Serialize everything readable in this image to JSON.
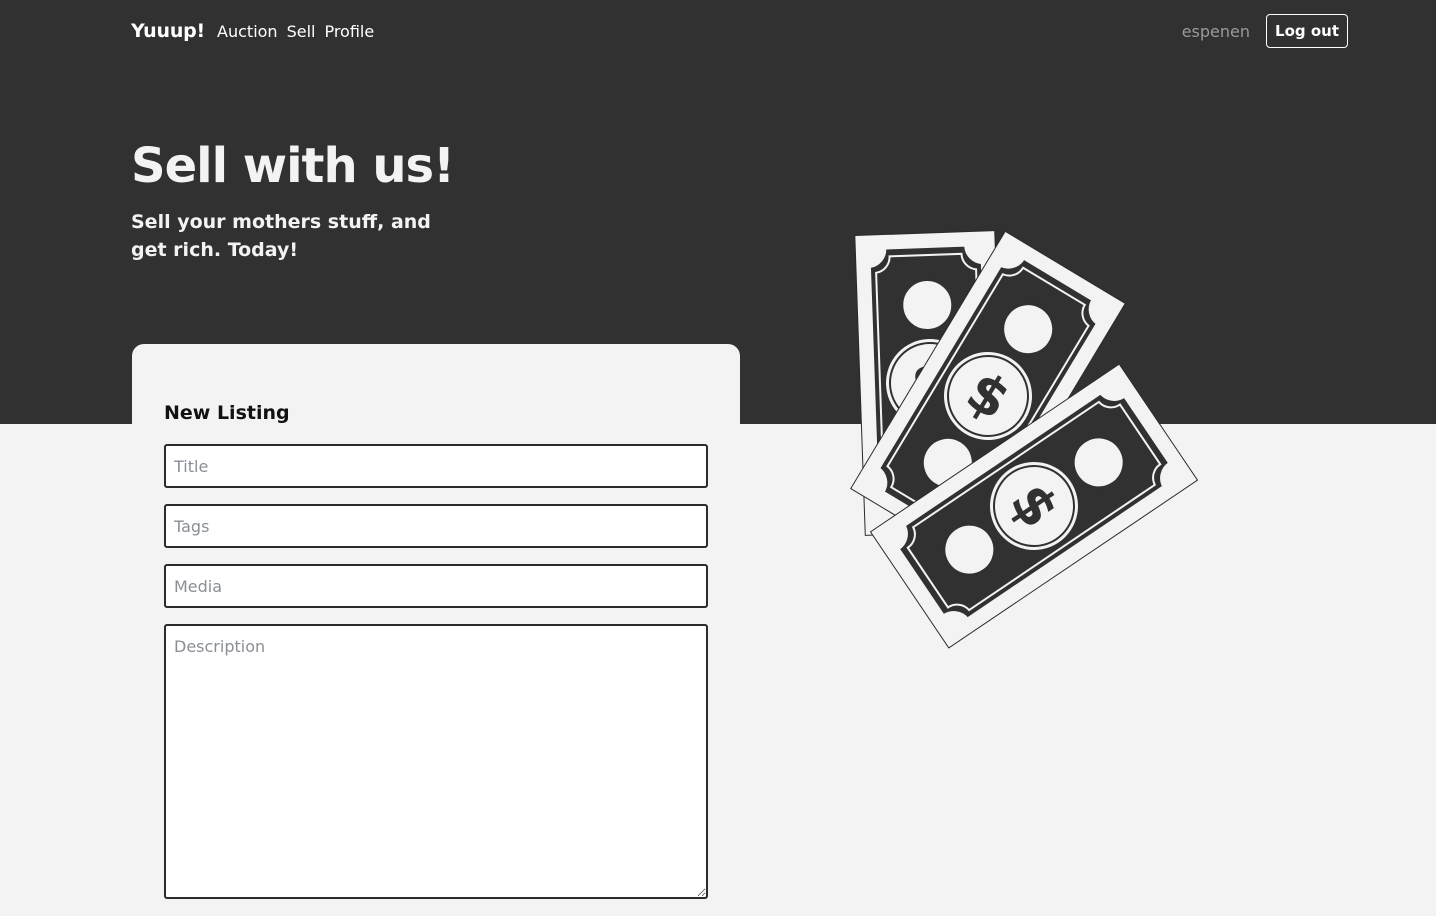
{
  "nav": {
    "brand": "Yuuup!",
    "links": [
      "Auction",
      "Sell",
      "Profile"
    ],
    "username": "espenen",
    "logout_label": "Log out"
  },
  "hero": {
    "title": "Sell with us!",
    "subtitle": "Sell your mothers stuff, and get rich. Today!"
  },
  "form": {
    "heading": "New Listing",
    "fields": {
      "title": {
        "placeholder": "Title",
        "value": ""
      },
      "tags": {
        "placeholder": "Tags",
        "value": ""
      },
      "media": {
        "placeholder": "Media",
        "value": ""
      },
      "description": {
        "placeholder": "Description",
        "value": ""
      }
    }
  },
  "illustration": {
    "icon": "money-bills-icon"
  },
  "colors": {
    "header_bg": "#313131",
    "page_bg": "#f3f3f3",
    "text_light": "#ffffff",
    "muted": "#9a9a9a"
  }
}
